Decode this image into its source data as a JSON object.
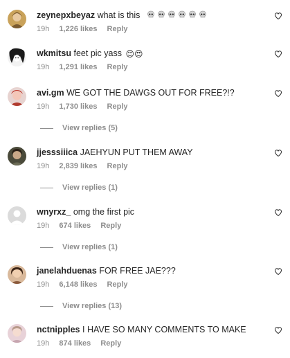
{
  "comments": [
    {
      "username": "zeynepxbeyaz",
      "text": "what is this",
      "emoji": "💀💀💀💀💀💀",
      "time": "19h",
      "likes": "1,226 likes",
      "reply": "Reply",
      "replies": ""
    },
    {
      "username": "wkmitsu",
      "text": "feet pic yass",
      "emoji": "😊😍",
      "time": "19h",
      "likes": "1,291 likes",
      "reply": "Reply",
      "replies": ""
    },
    {
      "username": "avi.gm",
      "text": "WE GOT THE DAWGS OUT FOR FREE?!?",
      "emoji": "",
      "time": "19h",
      "likes": "1,730 likes",
      "reply": "Reply",
      "replies": "View replies (5)"
    },
    {
      "username": "jjesssiiica",
      "text": "JAEHYUN PUT THEM AWAY",
      "emoji": "",
      "time": "19h",
      "likes": "2,839 likes",
      "reply": "Reply",
      "replies": "View replies (1)"
    },
    {
      "username": "wnyrxz_",
      "text": "omg the first pic",
      "emoji": "",
      "time": "19h",
      "likes": "674 likes",
      "reply": "Reply",
      "replies": "View replies (1)"
    },
    {
      "username": "janelahduenas",
      "text": "FOR FREE JAE???",
      "emoji": "",
      "time": "19h",
      "likes": "6,148 likes",
      "reply": "Reply",
      "replies": "View replies (13)"
    },
    {
      "username": "nctnipples",
      "text": "I HAVE SO MANY COMMENTS TO MAKE",
      "emoji": "",
      "time": "19h",
      "likes": "874 likes",
      "reply": "Reply",
      "replies": ""
    }
  ]
}
